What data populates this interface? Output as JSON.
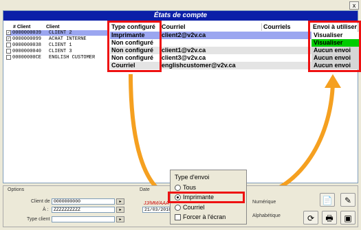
{
  "window": {
    "close_label": "x",
    "title": "États de compte"
  },
  "client_list": {
    "headers": [
      "# Client",
      "Client"
    ],
    "rows": [
      {
        "checked": true,
        "number": "0000000039",
        "name": "CLIENT 2",
        "selected": true
      },
      {
        "checked": true,
        "number": "0000000099",
        "name": "ACHAT INTERNE",
        "selected": false
      },
      {
        "checked": false,
        "number": "0000000038",
        "name": "CLIENT 1",
        "selected": false
      },
      {
        "checked": false,
        "number": "0000000040",
        "name": "CLIENT 3",
        "selected": false
      },
      {
        "checked": false,
        "number": "00000000CE",
        "name": "ENGLISH CUSTOMER",
        "selected": false
      }
    ]
  },
  "grid": {
    "headers": {
      "type": "Type configuré",
      "courriel": "Courriel",
      "refused": "Courriels refusés",
      "envoi": "Envoi à utiliser"
    },
    "rows": [
      {
        "type": "Imprimante",
        "courriel": "client2@v2v.ca",
        "envoi": "Visualiser"
      },
      {
        "type": "Non configuré",
        "courriel": "",
        "envoi": "Visualiser"
      },
      {
        "type": "Non configuré",
        "courriel": "client1@v2v.ca",
        "envoi": "Aucun envoi"
      },
      {
        "type": "Non configuré",
        "courriel": "client3@v2v.ca",
        "envoi": "Aucun envoi"
      },
      {
        "type": "Courriel",
        "courriel": "englishcustomer@v2v.ca",
        "envoi": "Aucun envoi"
      }
    ]
  },
  "options": {
    "group_label": "Options",
    "client_from_label": "Client de :",
    "client_from_value": "0000000000",
    "client_to_label": "À :",
    "client_to_value": "ZZZZZZZZZZ",
    "type_client_label": "Type client :",
    "type_client_value": ""
  },
  "date": {
    "group_label": "Date",
    "format_hint": "JJ/MM/AAA",
    "value": "21/03/2016"
  },
  "sort": {
    "numeric_label": "Numérique",
    "alpha_label": "Alphabétique"
  },
  "popup": {
    "title": "Type d'envoi",
    "options": [
      "Tous",
      "Imprimante",
      "Courriel"
    ],
    "selected": "Imprimante",
    "force_label": "Forcer à l'écran"
  },
  "colors": {
    "title_bg": "#0b1fa8",
    "highlight": "#e11111",
    "arrow": "#f5a020",
    "green": "#00cc00"
  }
}
